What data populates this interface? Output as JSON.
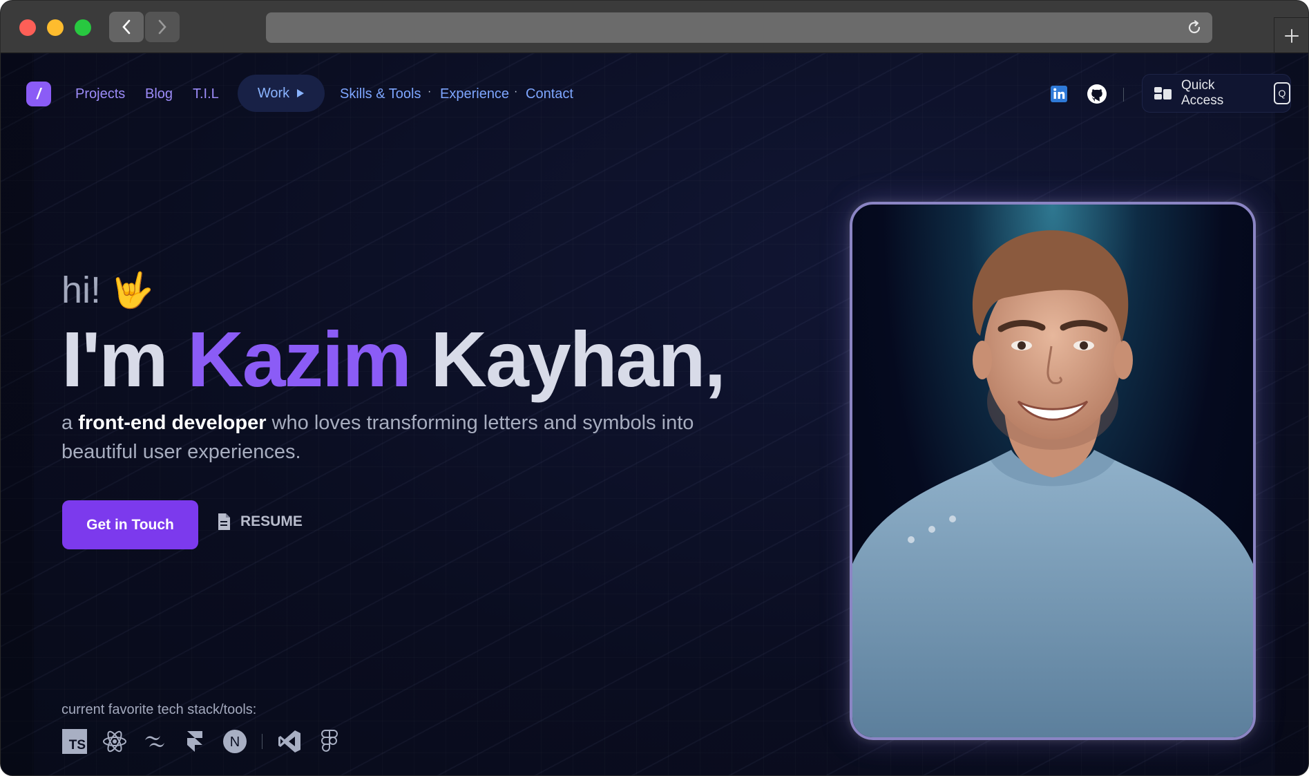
{
  "nav": {
    "logo_text": "/",
    "links": {
      "projects": "Projects",
      "blog": "Blog",
      "til": "T.I.L",
      "work": "Work",
      "skills": "Skills & Tools",
      "experience": "Experience",
      "contact": "Contact"
    },
    "separator": "·",
    "quick_access": "Quick Access",
    "quick_access_key": "Q"
  },
  "hero": {
    "greeting": "hi!",
    "greeting_emoji": "🤟",
    "headline_prefix": "I'm ",
    "headline_first": "Kazim",
    "headline_last": " Kayhan,",
    "tagline_a": "a ",
    "tagline_bold": "front-end developer",
    "tagline_rest": " who loves transforming letters and symbols into beautiful user experiences.",
    "cta_label": "Get in Touch",
    "resume_label": "RESUME",
    "stack_label": "current favorite tech stack/tools:",
    "ts_label": "TS",
    "next_label": "N"
  },
  "icons": {
    "linkedin": "linkedin-icon",
    "github": "github-icon",
    "tools": [
      "typescript-icon",
      "react-icon",
      "tailwind-icon",
      "framer-icon",
      "nextjs-icon",
      "vscode-icon",
      "figma-icon"
    ]
  },
  "colors": {
    "accent": "#8b5cf6",
    "button": "#7c3aed",
    "background": "#0b0f22",
    "link_blue": "#7ea6ff"
  }
}
